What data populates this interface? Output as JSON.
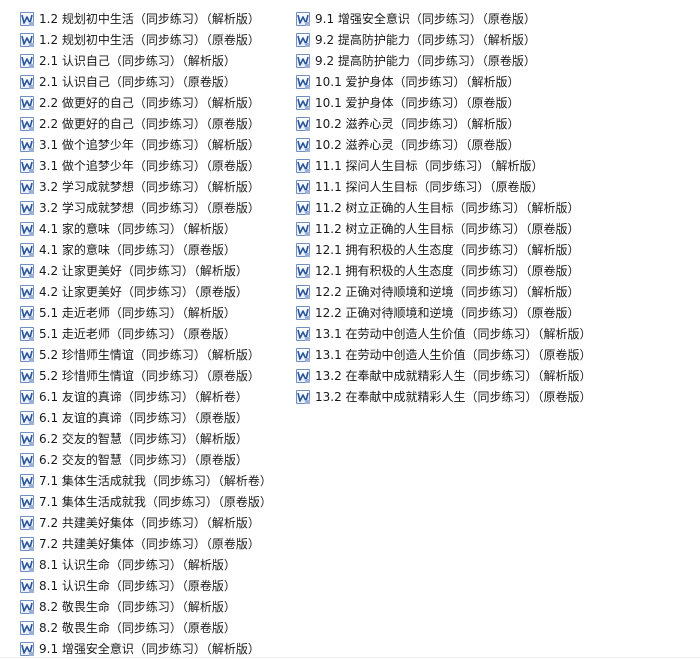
{
  "icon": "word-document-icon",
  "accent": "#2b579a",
  "files_left": [
    "1.2 规划初中生活（同步练习）（解析版）",
    "1.2 规划初中生活（同步练习）（原卷版）",
    "2.1 认识自己（同步练习）（解析版）",
    "2.1 认识自己（同步练习）（原卷版）",
    "2.2 做更好的自己（同步练习）（解析版）",
    "2.2 做更好的自己（同步练习）（原卷版）",
    "3.1 做个追梦少年（同步练习）（解析版）",
    "3.1 做个追梦少年（同步练习）（原卷版）",
    "3.2 学习成就梦想（同步练习）（解析版）",
    "3.2 学习成就梦想（同步练习）（原卷版）",
    "4.1 家的意味（同步练习）（解析版）",
    "4.1 家的意味（同步练习）（原卷版）",
    "4.2 让家更美好（同步练习）（解析版）",
    "4.2 让家更美好（同步练习）（原卷版）",
    "5.1 走近老师（同步练习）（解析版）",
    "5.1 走近老师（同步练习）（原卷版）",
    "5.2 珍惜师生情谊（同步练习）（解析版）",
    "5.2 珍惜师生情谊（同步练习）（原卷版）",
    "6.1 友谊的真谛（同步练习）（解析卷）",
    "6.1 友谊的真谛（同步练习）（原卷版）",
    "6.2 交友的智慧（同步练习）（解析版）",
    "6.2 交友的智慧（同步练习）（原卷版）",
    "7.1 集体生活成就我（同步练习）（解析卷）",
    "7.1 集体生活成就我（同步练习）（原卷版）",
    "7.2 共建美好集体（同步练习）（解析版）",
    "7.2 共建美好集体（同步练习）（原卷版）",
    "8.1 认识生命（同步练习）（解析版）",
    "8.1 认识生命（同步练习）（原卷版）",
    "8.2 敬畏生命（同步练习）（解析版）",
    "8.2 敬畏生命（同步练习）（原卷版）",
    "9.1 增强安全意识（同步练习）（解析版）"
  ],
  "files_right": [
    "9.1 增强安全意识（同步练习）（原卷版）",
    "9.2 提高防护能力（同步练习）（解析版）",
    "9.2 提高防护能力（同步练习）（原卷版）",
    "10.1 爱护身体（同步练习）（解析版）",
    "10.1 爱护身体（同步练习）（原卷版）",
    "10.2 滋养心灵（同步练习）（解析版）",
    "10.2 滋养心灵（同步练习）（原卷版）",
    "11.1 探问人生目标（同步练习）（解析版）",
    "11.1 探问人生目标（同步练习）（原卷版）",
    "11.2 树立正确的人生目标（同步练习）（解析版）",
    "11.2 树立正确的人生目标（同步练习）（原卷版）",
    "12.1 拥有积极的人生态度（同步练习）（解析版）",
    "12.1 拥有积极的人生态度（同步练习）（原卷版）",
    "12.2 正确对待顺境和逆境（同步练习）（解析版）",
    "12.2 正确对待顺境和逆境（同步练习）（原卷版）",
    "13.1 在劳动中创造人生价值（同步练习）（解析版）",
    "13.1 在劳动中创造人生价值（同步练习）（原卷版）",
    "13.2 在奉献中成就精彩人生（同步练习）（解析版）",
    "13.2 在奉献中成就精彩人生（同步练习）（原卷版）"
  ]
}
